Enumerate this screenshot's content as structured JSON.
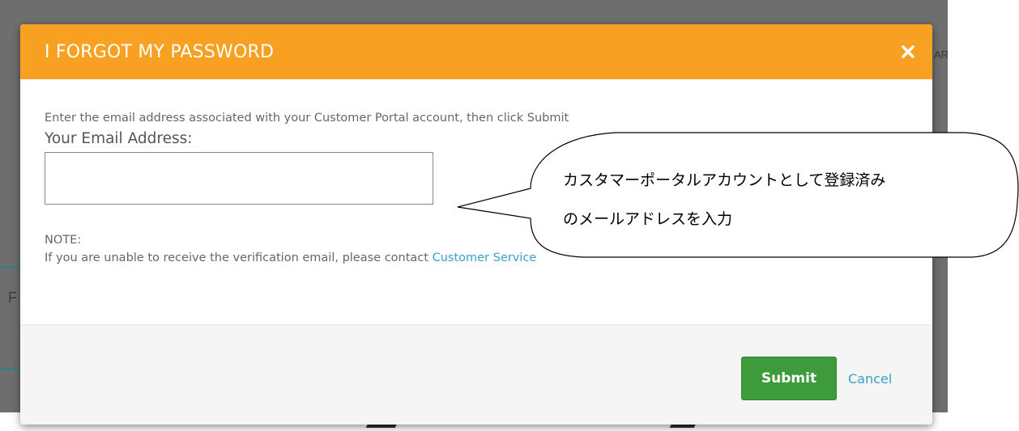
{
  "background": {
    "fragment_right": "AR",
    "fragment_left": "F"
  },
  "modal": {
    "title": "I FORGOT MY PASSWORD",
    "close_icon": "close-icon",
    "instruction": "Enter the email address associated with your Customer Portal account, then click Submit",
    "email_label": "Your Email Address:",
    "email_value": "",
    "note_label": "NOTE:",
    "note_text": "If you are unable to receive the verification email, please contact ",
    "note_link": "Customer Service",
    "submit_label": "Submit",
    "cancel_label": "Cancel"
  },
  "callout": {
    "line1": "カスタマーポータルアカウントとして登録済み",
    "line2": "のメールアドレスを入力"
  },
  "colors": {
    "header": "#f7a021",
    "submit": "#3e9b3b",
    "link": "#3aa0c9",
    "backdrop": "#6e6e6e"
  }
}
